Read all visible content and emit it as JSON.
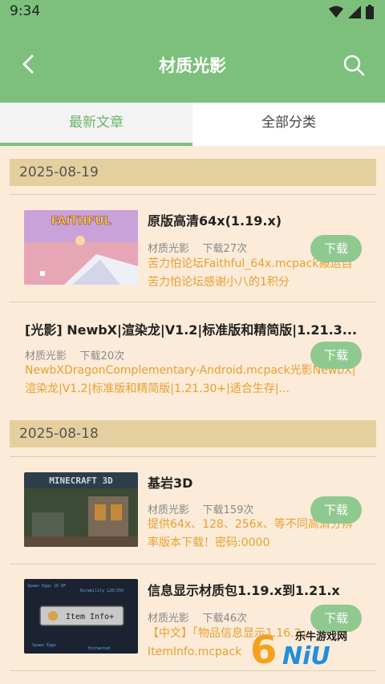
{
  "status": {
    "time": "9:34"
  },
  "header": {
    "title": "材质光影"
  },
  "tabs": [
    {
      "label": "最新文章"
    },
    {
      "label": "全部分类"
    }
  ],
  "sections": [
    {
      "date": "2025-08-19",
      "items": [
        {
          "title": "原版高清64x(1.19.x)",
          "category": "材质光影",
          "downloads": "下载27次",
          "desc": "苦力怕论坛Faithful_64x.mcpack搬运自苦力怕论坛感谢小八的1积分",
          "button": "下载",
          "thumb_text": "FAITHFUL"
        },
        {
          "title": "[光影] NewbX|渲染龙|V1.2|标准版和精简版|1.21.3...",
          "category": "材质光影",
          "downloads": "下载20次",
          "desc": "NewbXDragonComplementary-Android.mcpack光影NewbX|渲染龙|V1.2|标准版和精简版|1.21.30+|适合生存|...",
          "button": "下载"
        }
      ]
    },
    {
      "date": "2025-08-18",
      "items": [
        {
          "title": "基岩3D",
          "category": "材质光影",
          "downloads": "下载159次",
          "desc": "提供64x、128、256x、等不同高清分辨率版本下载！密码:0000",
          "button": "下载",
          "thumb_text": "MINECRAFT 3D"
        },
        {
          "title": "信息显示材质包1.19.x到1.21.x",
          "category": "材质光影",
          "downloads": "下载46次",
          "desc": "【中文】「物品信息显示1.16.2」ItemInfo.mcpack",
          "button": "下载",
          "thumb_text": "Item Info+"
        }
      ]
    }
  ],
  "watermark": {
    "text": "乐牛游戏网",
    "brand": "NiU"
  },
  "colors": {
    "accent": "#7cc07c",
    "desc": "#e8a030",
    "date_bar": "#e4cf9e",
    "background": "#fcebd8"
  }
}
